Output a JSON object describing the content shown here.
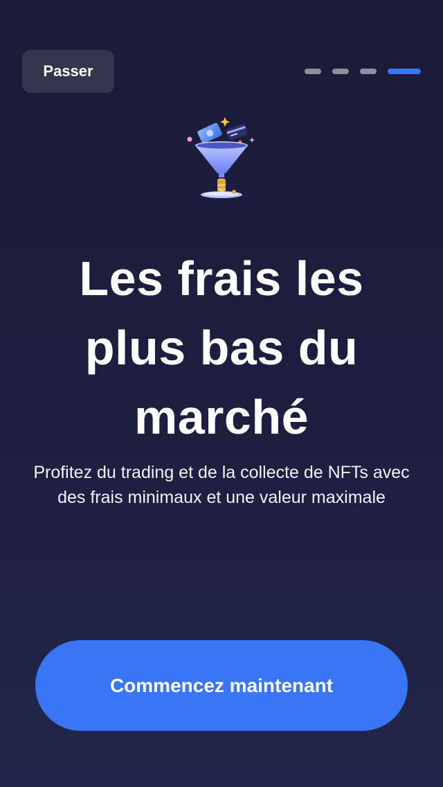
{
  "header": {
    "skip_label": "Passer",
    "pager": {
      "total": 4,
      "current": 4
    }
  },
  "hero": {
    "icon": "funnel-money-icon",
    "title": "Les frais les plus bas du marché",
    "subtitle": "Profitez du trading et de la collecte de NFTs avec des frais minimaux et une valeur maximale"
  },
  "footer": {
    "cta_label": "Commencez maintenant"
  },
  "colors": {
    "background": "#1e1f41",
    "skip_button_bg": "#34364d",
    "accent": "#3a75f6",
    "pager_inactive": "#8e8f9e"
  }
}
